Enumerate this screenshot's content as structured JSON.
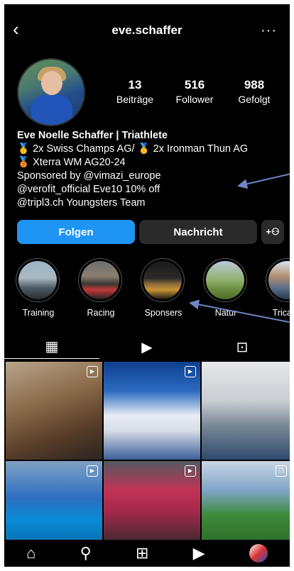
{
  "header": {
    "username": "eve.schaffer",
    "back_icon": "chevron-left-icon",
    "more_icon": "more-horizontal-icon"
  },
  "profile": {
    "stats": [
      {
        "value": "13",
        "label": "Beiträge"
      },
      {
        "value": "516",
        "label": "Follower"
      },
      {
        "value": "988",
        "label": "Gefolgt"
      }
    ],
    "bio": {
      "name": "Eve Noelle Schaffer | Triathlete",
      "line1": "🥇 2x Swiss Champs AG/ 🥇 2x Ironman Thun AG",
      "line2": "🥉 Xterra WM AG20-24",
      "line3": "Sponsored by @vimazi_europe",
      "line4": "@verofit_official Eve10 10% off",
      "line5": "@tripl3.ch Youngsters Team"
    }
  },
  "actions": {
    "follow": "Folgen",
    "message": "Nachricht",
    "add_icon": "add-person-icon"
  },
  "highlights": [
    {
      "label": "Training"
    },
    {
      "label": "Racing"
    },
    {
      "label": "Sponsers"
    },
    {
      "label": "Natur"
    },
    {
      "label": "Tricamp"
    }
  ],
  "tabs": [
    "grid-icon",
    "reels-icon",
    "tagged-icon"
  ],
  "nav": [
    "home-icon",
    "search-icon",
    "add-post-icon",
    "reels-icon",
    "profile-icon"
  ],
  "colors": {
    "accent": "#1e95f5",
    "background": "#000000",
    "arrow": "#6e86c6"
  }
}
